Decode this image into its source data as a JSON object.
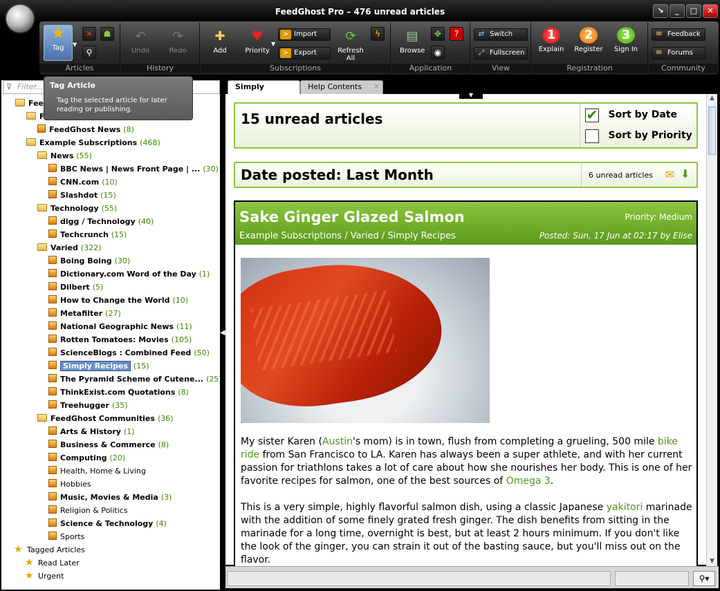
{
  "window": {
    "title": "FeedGhost Pro – 476 unread articles"
  },
  "ribbon": {
    "groups": {
      "articles": "Articles",
      "history": "History",
      "subscriptions": "Subscriptions",
      "application": "Application",
      "view": "View",
      "registration": "Registration",
      "community": "Community"
    },
    "buttons": {
      "tag": "Tag",
      "undo": "Undo",
      "redo": "Redo",
      "add": "Add",
      "priority": "Priority",
      "import": "Import",
      "export": "Export",
      "refresh_all": "Refresh All",
      "browse": "Browse",
      "switch": "Switch",
      "fullscreen": "Fullscreen",
      "explain": "Explain",
      "register": "Register",
      "sign_in": "Sign In",
      "feedback": "Feedback",
      "forums": "Forums"
    },
    "step_numbers": {
      "explain": "1",
      "register": "2",
      "sign_in": "3"
    }
  },
  "tooltip": {
    "title": "Tag Article",
    "description": "Tag the selected article for later reading or publishing."
  },
  "sidebar": {
    "filter_placeholder": "Filter...",
    "root_label": "Feed",
    "items": [
      {
        "label": "F",
        "count": ""
      },
      {
        "label": "FeedGhost News",
        "count": "(8)"
      },
      {
        "label": "Example Subscriptions",
        "count": "(468)"
      },
      {
        "label": "News",
        "count": "(55)"
      },
      {
        "label": "BBC News | News Front Page | ...",
        "count": "(30)"
      },
      {
        "label": "CNN.com",
        "count": "(10)"
      },
      {
        "label": "Slashdot",
        "count": "(15)"
      },
      {
        "label": "Technology",
        "count": "(55)"
      },
      {
        "label": "digg / Technology",
        "count": "(40)"
      },
      {
        "label": "Techcrunch",
        "count": "(15)"
      },
      {
        "label": "Varied",
        "count": "(322)"
      },
      {
        "label": "Boing Boing",
        "count": "(30)"
      },
      {
        "label": "Dictionary.com Word of the Day",
        "count": "(1)"
      },
      {
        "label": "Dilbert",
        "count": "(5)"
      },
      {
        "label": "How to Change the World",
        "count": "(10)"
      },
      {
        "label": "Metafilter",
        "count": "(27)"
      },
      {
        "label": "National Geographic News",
        "count": "(11)"
      },
      {
        "label": "Rotten Tomatoes: Movies",
        "count": "(105)"
      },
      {
        "label": "ScienceBlogs : Combined Feed",
        "count": "(50)"
      },
      {
        "label": "Simply Recipes",
        "count": "(15)"
      },
      {
        "label": "The Pyramid Scheme of Cutene...",
        "count": "(25)"
      },
      {
        "label": "ThinkExist.com Quotations",
        "count": "(8)"
      },
      {
        "label": "Treehugger",
        "count": "(35)"
      },
      {
        "label": "FeedGhost Communities",
        "count": "(36)"
      },
      {
        "label": "Arts & History",
        "count": "(1)"
      },
      {
        "label": "Business & Commerce",
        "count": "(8)"
      },
      {
        "label": "Computing",
        "count": "(20)"
      },
      {
        "label": "Health, Home & Living",
        "count": ""
      },
      {
        "label": "Hobbies",
        "count": ""
      },
      {
        "label": "Music, Movies & Media",
        "count": "(3)"
      },
      {
        "label": "Religion & Politics",
        "count": ""
      },
      {
        "label": "Science & Technology",
        "count": "(4)"
      },
      {
        "label": "Sports",
        "count": ""
      },
      {
        "label": "Tagged Articles",
        "count": ""
      },
      {
        "label": "Read Later",
        "count": ""
      },
      {
        "label": "Urgent",
        "count": ""
      }
    ]
  },
  "tabs": [
    "Simply Recipes",
    "Help Contents"
  ],
  "summary": {
    "unread": "15 unread articles",
    "sort_date": "Sort by Date",
    "sort_priority": "Sort by Priority"
  },
  "date_group": {
    "title": "Date posted: Last Month",
    "count": "6 unread articles"
  },
  "article": {
    "title": "Sake Ginger Glazed Salmon",
    "priority": "Priority: Medium",
    "path": "Example Subscriptions / Varied / Simply Recipes",
    "posted": "Posted: Sun, 17 Jun at 02:17 by Elise",
    "p1": [
      "My sister Karen (",
      "Austin",
      "'s mom) is in town, flush from completing a grueling, 500 mile ",
      "bike ride",
      " from San Francisco to LA. Karen has always been a super athlete, and with her current passion for triathlons takes a lot of care about how she nourishes her body. This is one of her favorite recipes for salmon, one of the best sources of ",
      "Omega 3",
      "."
    ],
    "p2": [
      "This is a very simple, highly flavorful salmon dish, using a classic Japanese ",
      "yakitori",
      " marinade with the addition of some finely grated fresh ginger. The dish benefits from sitting in the marinade for a long time, overnight is best, but at least 2 hours minimum. If you don't like the look of the ginger, you can strain it out of the basting sauce, but you'll miss out on the flavor."
    ]
  },
  "colors": {
    "accent_green": "#8cc63f",
    "link_green": "#4a9a1a",
    "count_green": "#3a8a00"
  }
}
